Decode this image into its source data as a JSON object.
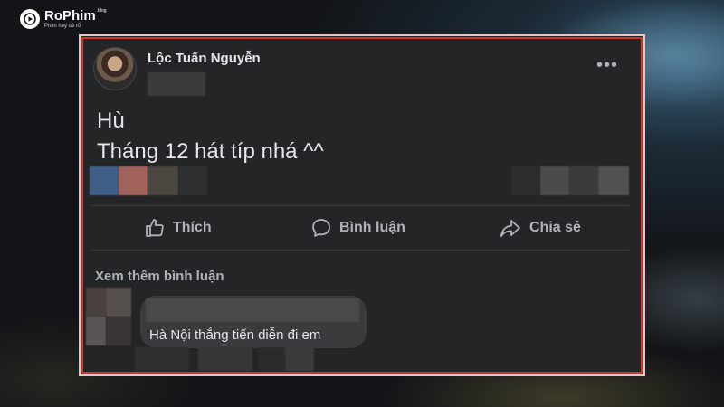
{
  "brand": {
    "name": "RoPhim",
    "suffix": ".blog",
    "tagline": "Phim hay cả rổ"
  },
  "post": {
    "author": "Lộc Tuấn Nguyễn",
    "lines": [
      "Hù",
      "Tháng 12 hát típ nhá ^^"
    ]
  },
  "actions": {
    "like": "Thích",
    "comment": "Bình luận",
    "share": "Chia sẻ"
  },
  "comments": {
    "see_more": "Xem thêm bình luận",
    "items": [
      {
        "text": "Hà Nội thắng tiến diễn đi em"
      }
    ]
  },
  "colors": {
    "card_bg": "#242526",
    "text_primary": "#e4e6eb",
    "text_secondary": "#b0b3b8",
    "frame_border": "#d93a30"
  }
}
